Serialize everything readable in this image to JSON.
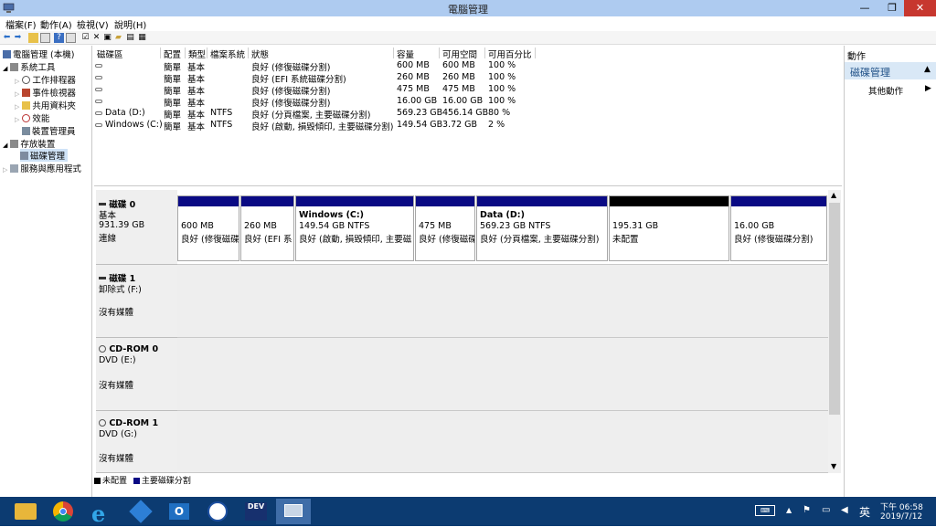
{
  "window": {
    "title": "電腦管理"
  },
  "window_controls": {
    "minimize": "—",
    "maximize": "❐",
    "close": "✕"
  },
  "menu": [
    "檔案(F)",
    "動作(A)",
    "檢視(V)",
    "說明(H)"
  ],
  "tree": {
    "root": "電腦管理 (本機)",
    "system_tools": "系統工具",
    "task_scheduler": "工作排程器",
    "event_viewer": "事件檢視器",
    "shared_folders": "共用資料夾",
    "performance": "效能",
    "device_manager": "裝置管理員",
    "storage": "存放裝置",
    "disk_management": "磁碟管理",
    "services": "服務與應用程式"
  },
  "volume_table": {
    "headers": [
      "磁碟區",
      "配置",
      "類型",
      "檔案系統",
      "狀態",
      "容量",
      "可用空間",
      "可用百分比"
    ],
    "rows": [
      {
        "name": "",
        "layout": "簡單",
        "type": "基本",
        "fs": "",
        "status": "良好 (修復磁碟分割)",
        "capacity": "600 MB",
        "free": "600 MB",
        "pct": "100 %"
      },
      {
        "name": "",
        "layout": "簡單",
        "type": "基本",
        "fs": "",
        "status": "良好 (EFI 系統磁碟分割)",
        "capacity": "260 MB",
        "free": "260 MB",
        "pct": "100 %"
      },
      {
        "name": "",
        "layout": "簡單",
        "type": "基本",
        "fs": "",
        "status": "良好 (修復磁碟分割)",
        "capacity": "475 MB",
        "free": "475 MB",
        "pct": "100 %"
      },
      {
        "name": "",
        "layout": "簡單",
        "type": "基本",
        "fs": "",
        "status": "良好 (修復磁碟分割)",
        "capacity": "16.00 GB",
        "free": "16.00 GB",
        "pct": "100 %"
      },
      {
        "name": "Data (D:)",
        "layout": "簡單",
        "type": "基本",
        "fs": "NTFS",
        "status": "良好 (分頁檔案, 主要磁碟分割)",
        "capacity": "569.23 GB",
        "free": "456.14 GB",
        "pct": "80 %"
      },
      {
        "name": "Windows (C:)",
        "layout": "簡單",
        "type": "基本",
        "fs": "NTFS",
        "status": "良好 (啟動, 損毀傾印, 主要磁碟分割)",
        "capacity": "149.54 GB",
        "free": "3.72 GB",
        "pct": "2 %"
      }
    ]
  },
  "disks": {
    "disk0": {
      "name": "磁碟 0",
      "type": "基本",
      "size": "931.39 GB",
      "state": "連線",
      "partitions": [
        {
          "title": "",
          "size": "600 MB",
          "status": "良好 (修復磁碟"
        },
        {
          "title": "",
          "size": "260 MB",
          "status": "良好 (EFI 系"
        },
        {
          "title": "Windows  (C:)",
          "size": "149.54 GB NTFS",
          "status": "良好 (啟動, 損毀傾印, 主要磁"
        },
        {
          "title": "",
          "size": "475 MB",
          "status": "良好 (修復磁碟"
        },
        {
          "title": "Data  (D:)",
          "size": "569.23 GB NTFS",
          "status": "良好 (分頁檔案, 主要磁碟分割)"
        },
        {
          "title": "",
          "size": "195.31 GB",
          "status": "未配置"
        },
        {
          "title": "",
          "size": "16.00 GB",
          "status": "良好 (修復磁碟分割)"
        }
      ]
    },
    "disk1": {
      "name": "磁碟 1",
      "type": "卸除式 (F:)",
      "media": "沒有媒體"
    },
    "cdrom0": {
      "name": "CD-ROM 0",
      "type": "DVD (E:)",
      "media": "沒有媒體"
    },
    "cdrom1": {
      "name": "CD-ROM 1",
      "type": "DVD (G:)",
      "media": "沒有媒體"
    }
  },
  "legend": {
    "unallocated": "未配置",
    "primary": "主要磁碟分割"
  },
  "actions": {
    "title": "動作",
    "section": "磁碟管理",
    "more": "其他動作"
  },
  "taskbar": {
    "dev_label": "DEV",
    "ime": "英",
    "time": "下午 06:58",
    "date": "2019/7/12"
  },
  "colors": {
    "primary_partition": "#0a0a84",
    "unallocated": "#000000",
    "taskbar": "#0c3b71",
    "close_button": "#c7372f"
  }
}
